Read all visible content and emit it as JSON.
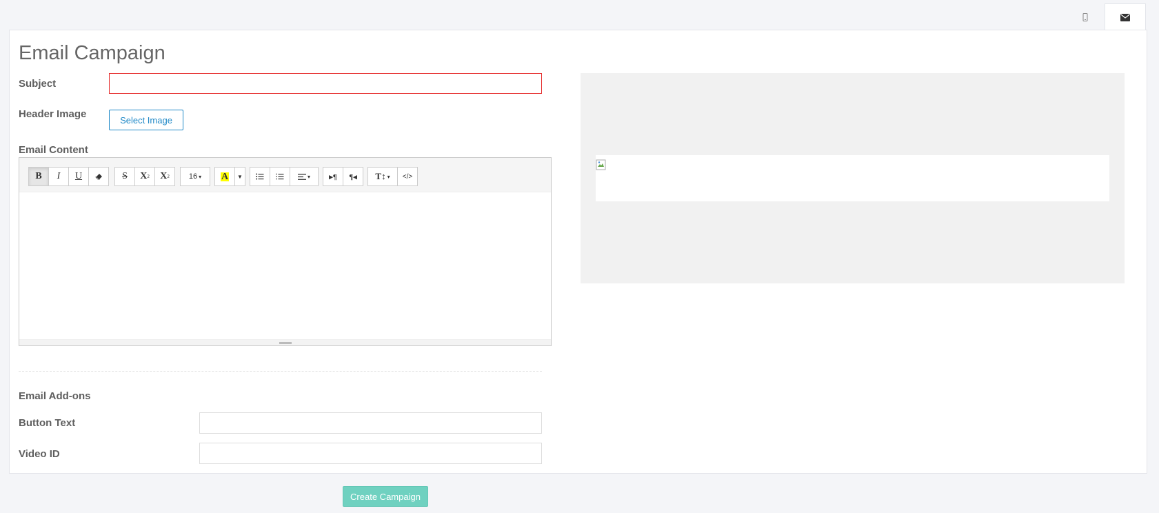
{
  "tabs": {
    "mobile_icon": "mobile-icon",
    "email_icon": "envelope-icon"
  },
  "page": {
    "title": "Email Campaign"
  },
  "form": {
    "subject_label": "Subject",
    "subject_value": "",
    "header_image_label": "Header Image",
    "select_image_button": "Select Image",
    "email_content_label": "Email Content",
    "addons_heading": "Email Add-ons",
    "button_text_label": "Button Text",
    "button_text_value": "",
    "video_id_label": "Video ID",
    "video_id_value": ""
  },
  "editor": {
    "bold": "B",
    "italic": "I",
    "underline": "U",
    "strike": "S",
    "superscript": "X",
    "subscript": "X",
    "font_size": "16",
    "highlight": "A",
    "code_view": "</>"
  },
  "footer": {
    "create_button": "Create Campaign"
  },
  "colors": {
    "accent": "#1e88c7",
    "error_border": "#e52b2b",
    "create_button": "#6fd1c0",
    "highlight_yellow": "#ffff00"
  }
}
